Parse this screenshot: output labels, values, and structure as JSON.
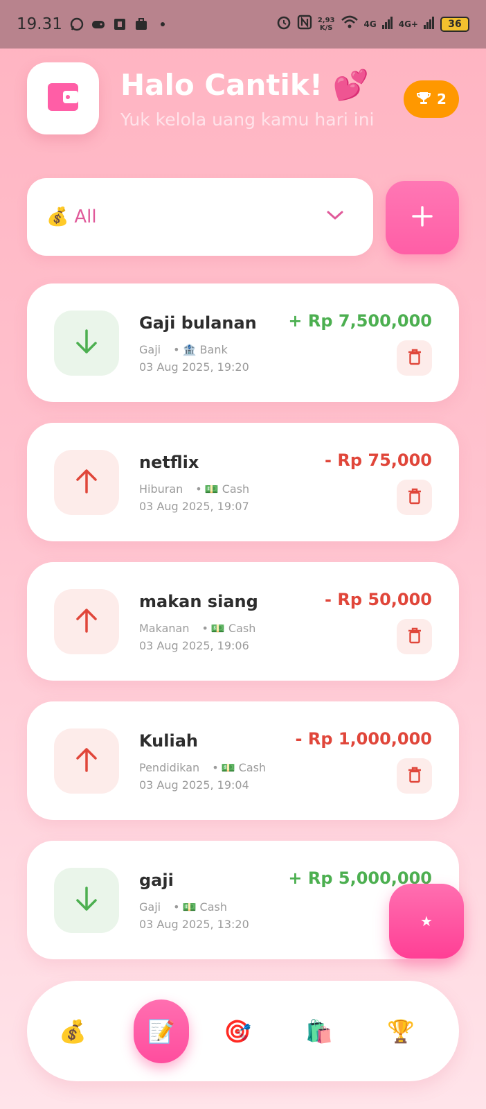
{
  "status_bar": {
    "time": "19.31",
    "net_speed_value": "2,93",
    "net_speed_unit": "K/S",
    "signal1": "4G",
    "signal2": "4G+",
    "battery": "36"
  },
  "header": {
    "greeting": "Halo Cantik! 💕",
    "subtitle": "Yuk kelola uang kamu hari ini",
    "trophy_count": "2"
  },
  "filter": {
    "emoji": "💰",
    "selected": "All"
  },
  "transactions": [
    {
      "title": "Gaji bulanan",
      "category": "Gaji",
      "account": "🏦 Bank",
      "date": "03 Aug 2025, 19:20",
      "amount": "+ Rp 7,500,000",
      "type": "income"
    },
    {
      "title": "netflix",
      "category": "Hiburan",
      "account": "💵 Cash",
      "date": "03 Aug 2025, 19:07",
      "amount": "- Rp 75,000",
      "type": "expense"
    },
    {
      "title": "makan siang",
      "category": "Makanan",
      "account": "💵 Cash",
      "date": "03 Aug 2025, 19:06",
      "amount": "- Rp 50,000",
      "type": "expense"
    },
    {
      "title": "Kuliah",
      "category": "Pendidikan",
      "account": "💵 Cash",
      "date": "03 Aug 2025, 19:04",
      "amount": "- Rp 1,000,000",
      "type": "expense"
    },
    {
      "title": "gaji",
      "category": "Gaji",
      "account": "💵 Cash",
      "date": "03 Aug 2025, 13:20",
      "amount": "+ Rp 5,000,000",
      "type": "income"
    }
  ],
  "fab": {
    "icon": "★"
  },
  "nav": [
    {
      "icon": "💰",
      "name": "money-bag-icon"
    },
    {
      "icon": "📝",
      "name": "memo-icon"
    },
    {
      "icon": "🎯",
      "name": "target-icon"
    },
    {
      "icon": "🛍️",
      "name": "shopping-bags-icon"
    },
    {
      "icon": "🏆",
      "name": "trophy-icon"
    }
  ],
  "colors": {
    "income": "#4caf50",
    "expense": "#e0463a",
    "accent": "#ff5ea6",
    "badge": "#ff9800"
  }
}
